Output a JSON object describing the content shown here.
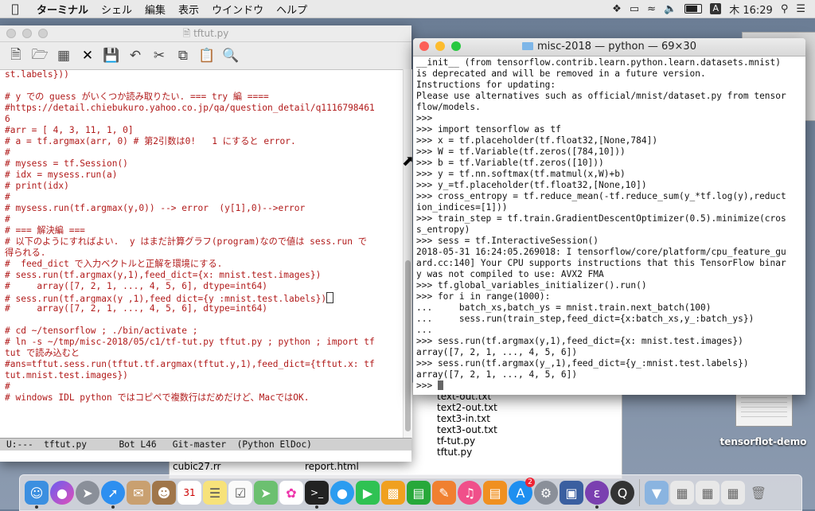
{
  "menubar": {
    "apple": "",
    "items": [
      "ターミナル",
      "シェル",
      "編集",
      "表示",
      "ウインドウ",
      "ヘルプ"
    ],
    "input_indicator": "A",
    "clock": "木 16:29"
  },
  "emacs": {
    "title": "tftut.py",
    "buffer_lines": [
      "st.labels}))",
      "",
      "# y での guess がいくつか読み取りたい. === try 編 ====",
      "#https://detail.chiebukuro.yahoo.co.jp/qa/question_detail/q1116798461",
      "6",
      "#arr = [ 4, 3, 11, 1, 0]",
      "# a = tf.argmax(arr, 0) # 第2引数は0!   1 にすると error.",
      "#",
      "# mysess = tf.Session()",
      "# idx = mysess.run(a)",
      "# print(idx)",
      "#",
      "# mysess.run(tf.argmax(y,0)) --> error  (y[1],0)-->error",
      "#",
      "# === 解決編 ===",
      "# 以下のようにすればよい.  y はまだ計算グラフ(program)なので値は sess.run で",
      "得られる.",
      "#  feed_dict で入力ベクトルと正解を環境にする.",
      "# sess.run(tf.argmax(y,1),feed_dict={x: mnist.test.images})",
      "#     array([7, 2, 1, ..., 4, 5, 6], dtype=int64)",
      "# sess.run(tf.argmax(y_,1),feed_dict={y_:mnist.test.labels})",
      "#     array([7, 2, 1, ..., 4, 5, 6], dtype=int64)",
      "",
      "# cd ~/tensorflow ; ./bin/activate ;",
      "# ln -s ~/tmp/misc-2018/05/c1/tf-tut.py tftut.py ; python ; import tf",
      "tut で読み込むと",
      "#ans=tftut.sess.run(tftut.tf.argmax(tftut.y,1),feed_dict={tftut.x: tf",
      "tut.mnist.test.images})",
      "#",
      "# windows IDL python ではコピペで複数行はだめだけど、MacではOK."
    ],
    "modeline": "U:---  tftut.py      Bot L46   Git-master  (Python ElDoc)"
  },
  "terminal": {
    "title": "misc-2018 — python — 69×30",
    "lines": [
      "__init__ (from tensorflow.contrib.learn.python.learn.datasets.mnist)",
      "is deprecated and will be removed in a future version.",
      "Instructions for updating:",
      "Please use alternatives such as official/mnist/dataset.py from tensor",
      "flow/models.",
      ">>>",
      ">>> import tensorflow as tf",
      ">>> x = tf.placeholder(tf.float32,[None,784])",
      ">>> W = tf.Variable(tf.zeros([784,10]))",
      ">>> b = tf.Variable(tf.zeros([10]))",
      ">>> y = tf.nn.softmax(tf.matmul(x,W)+b)",
      ">>> y_=tf.placeholder(tf.float32,[None,10])",
      ">>> cross_entropy = tf.reduce_mean(-tf.reduce_sum(y_*tf.log(y),reduct",
      "ion_indices=[1]))",
      ">>> train_step = tf.train.GradientDescentOptimizer(0.5).minimize(cros",
      "s_entropy)",
      ">>> sess = tf.InteractiveSession()",
      "2018-05-31 16:24:05.269018: I tensorflow/core/platform/cpu_feature_gu",
      "ard.cc:140] Your CPU supports instructions that this TensorFlow binar",
      "y was not compiled to use: AVX2 FMA",
      ">>> tf.global_variables_initializer().run()",
      ">>> for i in range(1000):",
      "...     batch_xs,batch_ys = mnist.train.next_batch(100)",
      "...     sess.run(train_step,feed_dict={x:batch_xs,y_:batch_ys})",
      "...",
      ">>> sess.run(tf.argmax(y,1),feed_dict={x: mnist.test.images})",
      "array([7, 2, 1, ..., 4, 5, 6])",
      ">>> sess.run(tf.argmax(y_,1),feed_dict={y_:mnist.test.labels})",
      "array([7, 2, 1, ..., 4, 5, 6])",
      ">>> "
    ]
  },
  "finder": {
    "files": [
      "text-out.txt",
      "text2-out.txt",
      "text3-in.txt",
      "text3-out.txt",
      "tf-tut.py",
      "tftut.py"
    ],
    "bottom_row": [
      "cubic27.rr",
      "report.html"
    ]
  },
  "desktop": {
    "icon_label": "tensorflot-demo"
  },
  "dock": {
    "items": [
      "finder-icon",
      "siri-icon",
      "launchpad-icon",
      "safari-icon",
      "mail-icon",
      "contacts-icon",
      "calendar-icon",
      "notes-icon",
      "reminders-icon",
      "maps-icon",
      "photos-icon",
      "terminal-icon",
      "messages-icon",
      "facetime-icon",
      "keynote-icon",
      "numbers-icon",
      "pages-icon",
      "itunes-icon",
      "ibooks-icon",
      "appstore-icon",
      "preferences-icon",
      "virtualbox-icon",
      "emacs-icon",
      "quicktime-icon"
    ],
    "appstore_badge": "2"
  }
}
